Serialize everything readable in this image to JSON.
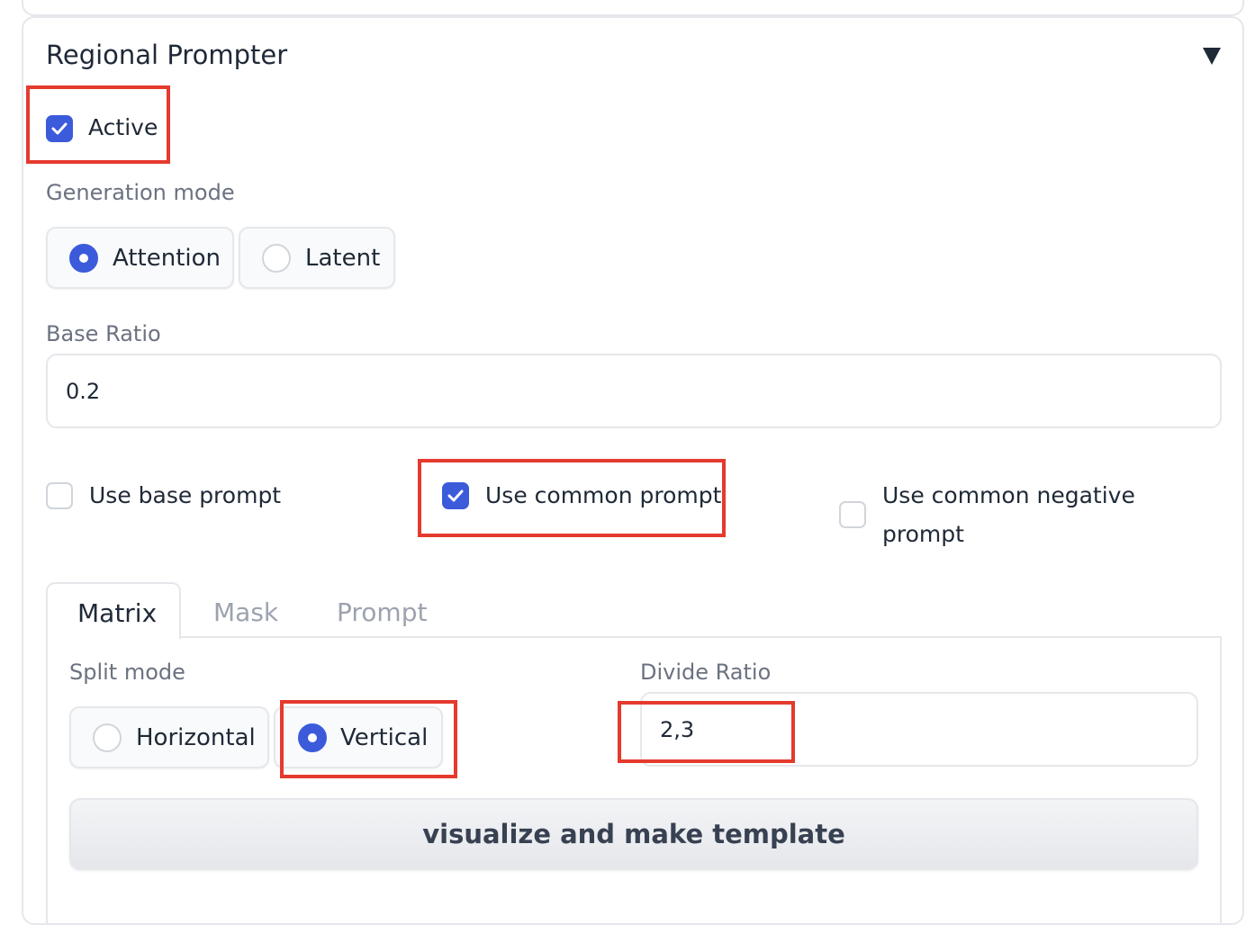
{
  "panel": {
    "title": "Regional Prompter"
  },
  "active": {
    "label": "Active",
    "checked": true
  },
  "generation_mode": {
    "label": "Generation mode",
    "options": [
      {
        "label": "Attention",
        "selected": true
      },
      {
        "label": "Latent",
        "selected": false
      }
    ]
  },
  "base_ratio": {
    "label": "Base Ratio",
    "value": "0.2"
  },
  "checkboxes": {
    "use_base_prompt": {
      "label": "Use base prompt",
      "checked": false
    },
    "use_common_prompt": {
      "label": "Use common prompt",
      "checked": true
    },
    "use_common_negative_prompt": {
      "label_line1": "Use common negative",
      "label_line2": "prompt",
      "checked": false
    }
  },
  "tabs": [
    {
      "label": "Matrix",
      "active": true
    },
    {
      "label": "Mask",
      "active": false
    },
    {
      "label": "Prompt",
      "active": false
    }
  ],
  "split_mode": {
    "label": "Split mode",
    "options": [
      {
        "label": "Horizontal",
        "selected": false
      },
      {
        "label": "Vertical",
        "selected": true
      }
    ]
  },
  "divide_ratio": {
    "label": "Divide Ratio",
    "value": "2,3"
  },
  "visualize_button": {
    "label": "visualize and make template"
  },
  "colors": {
    "accent": "#3b5bdb",
    "highlight": "#e53a2e"
  }
}
